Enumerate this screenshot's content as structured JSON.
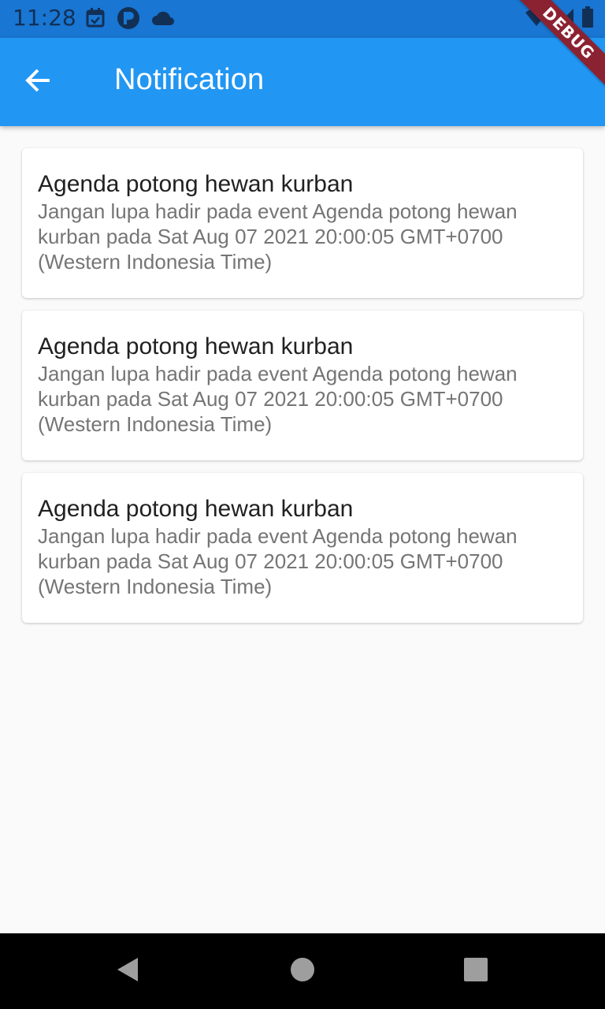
{
  "status_bar": {
    "time": "11:28",
    "icons_left": [
      "calendar-check-icon",
      "p-circle-icon",
      "cloud-icon"
    ],
    "icons_right": [
      "wifi-icon",
      "signal-icon",
      "battery-icon"
    ]
  },
  "app_bar": {
    "title": "Notification",
    "back_icon": "arrow-left-icon",
    "background_color": "#2196f3"
  },
  "debug_banner": "DEBUG",
  "notifications": [
    {
      "title": "Agenda potong hewan kurban",
      "body": "Jangan lupa hadir pada event Agenda potong hewan kurban pada Sat Aug 07 2021 20:00:05 GMT+0700 (Western Indonesia Time)"
    },
    {
      "title": "Agenda potong hewan kurban",
      "body": "Jangan lupa hadir pada event Agenda potong hewan kurban pada Sat Aug 07 2021 20:00:05 GMT+0700 (Western Indonesia Time)"
    },
    {
      "title": "Agenda potong hewan kurban",
      "body": "Jangan lupa hadir pada event Agenda potong hewan kurban pada Sat Aug 07 2021 20:00:05 GMT+0700 (Western Indonesia Time)"
    }
  ],
  "nav_bar": {
    "buttons": [
      "back-triangle-icon",
      "home-circle-icon",
      "recents-square-icon"
    ]
  }
}
